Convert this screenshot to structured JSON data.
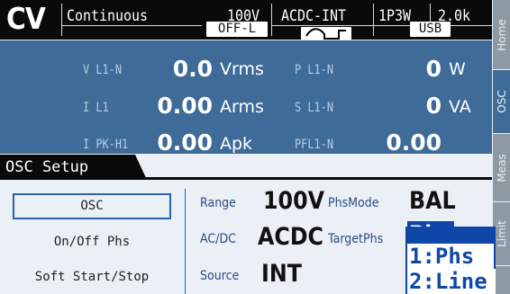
{
  "header": {
    "mode": "CV",
    "operation": "Continuous",
    "output_state": "OFF-L",
    "range": "100V",
    "source_mode": "ACDC-INT",
    "phase_config": "1P3W",
    "capacity": "2.0k",
    "interface": "USB"
  },
  "tabs": [
    {
      "label": "Home"
    },
    {
      "label": "OSC"
    },
    {
      "label": "Meas"
    },
    {
      "label": "Limit"
    }
  ],
  "measurements": {
    "voltage": {
      "label": "V L1-N",
      "value": "0.0",
      "unit": "Vrms"
    },
    "current": {
      "label": "I L1",
      "value": "0.00",
      "unit": "Arms"
    },
    "peak_current": {
      "label": "I PK-H1",
      "value": "0.00",
      "unit": "Apk"
    },
    "power": {
      "label": "P L1-N",
      "value": "0",
      "unit": "W"
    },
    "apparent_power": {
      "label": "S L1-N",
      "value": "0",
      "unit": "VA"
    },
    "power_factor": {
      "label": "PFL1-N",
      "value": "0.00"
    }
  },
  "setup": {
    "title": "OSC Setup",
    "menu": [
      {
        "label": "OSC",
        "selected": true
      },
      {
        "label": "On/Off Phs",
        "selected": false
      },
      {
        "label": "Soft Start/Stop",
        "selected": false
      }
    ],
    "params": {
      "range": {
        "label": "Range",
        "value": "100V"
      },
      "acdc": {
        "label": "AC/DC",
        "value": "ACDC"
      },
      "source": {
        "label": "Source",
        "value": "INT"
      },
      "phsmode": {
        "label": "PhsMode",
        "value": "BAL"
      },
      "targetphs": {
        "label": "TargetPhs",
        "value": "Phs"
      }
    }
  },
  "popup": {
    "options": [
      "1:Phs",
      "2:Line"
    ],
    "selected_index": 0
  },
  "colors": {
    "header_bg": "#0a0a0a",
    "meas_bg": "#3f6b99",
    "accent": "#2b63ad",
    "popup_bg": "#0f47a8",
    "panel_bg": "#eaf0f6"
  }
}
